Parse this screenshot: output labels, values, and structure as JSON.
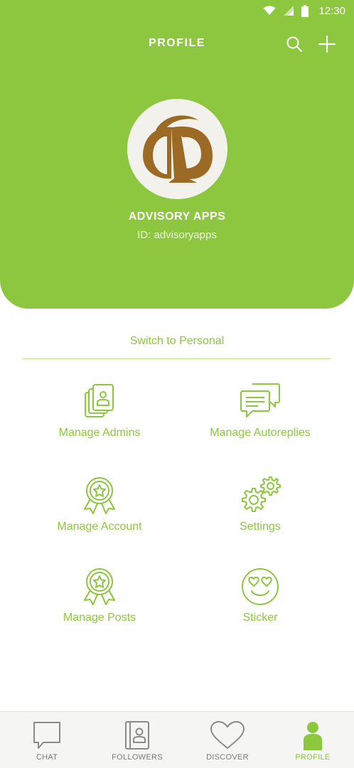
{
  "status_bar": {
    "time": "12:30"
  },
  "header": {
    "title": "PROFILE",
    "actions": [
      {
        "icon": "search-icon"
      },
      {
        "icon": "plus-icon"
      }
    ]
  },
  "profile": {
    "name": "ADVISORY APPS",
    "id_text": "ID: advisoryapps",
    "logo_letter": "a"
  },
  "switch_label": "Switch to Personal",
  "menu": [
    {
      "label": "Manage Admins",
      "icon": "admins-cards-icon"
    },
    {
      "label": "Manage Autoreplies",
      "icon": "chat-bubbles-icon"
    },
    {
      "label": "Manage Account",
      "icon": "award-badge-icon"
    },
    {
      "label": "Settings",
      "icon": "gears-icon"
    },
    {
      "label": "Manage Posts",
      "icon": "award-badge-icon"
    },
    {
      "label": "Sticker",
      "icon": "heart-eyes-emoji-icon"
    }
  ],
  "bottom_nav": [
    {
      "label": "CHAT",
      "icon": "chat-bubble-icon",
      "active": false
    },
    {
      "label": "FOLLOWERS",
      "icon": "contacts-book-icon",
      "active": false
    },
    {
      "label": "DISCOVER",
      "icon": "heart-icon",
      "active": false
    },
    {
      "label": "PROFILE",
      "icon": "person-icon",
      "active": true
    }
  ],
  "colors": {
    "brand_green": "#8dc63f",
    "logo_brown": "#9b6b26",
    "nav_inactive": "#7a7a7a"
  }
}
